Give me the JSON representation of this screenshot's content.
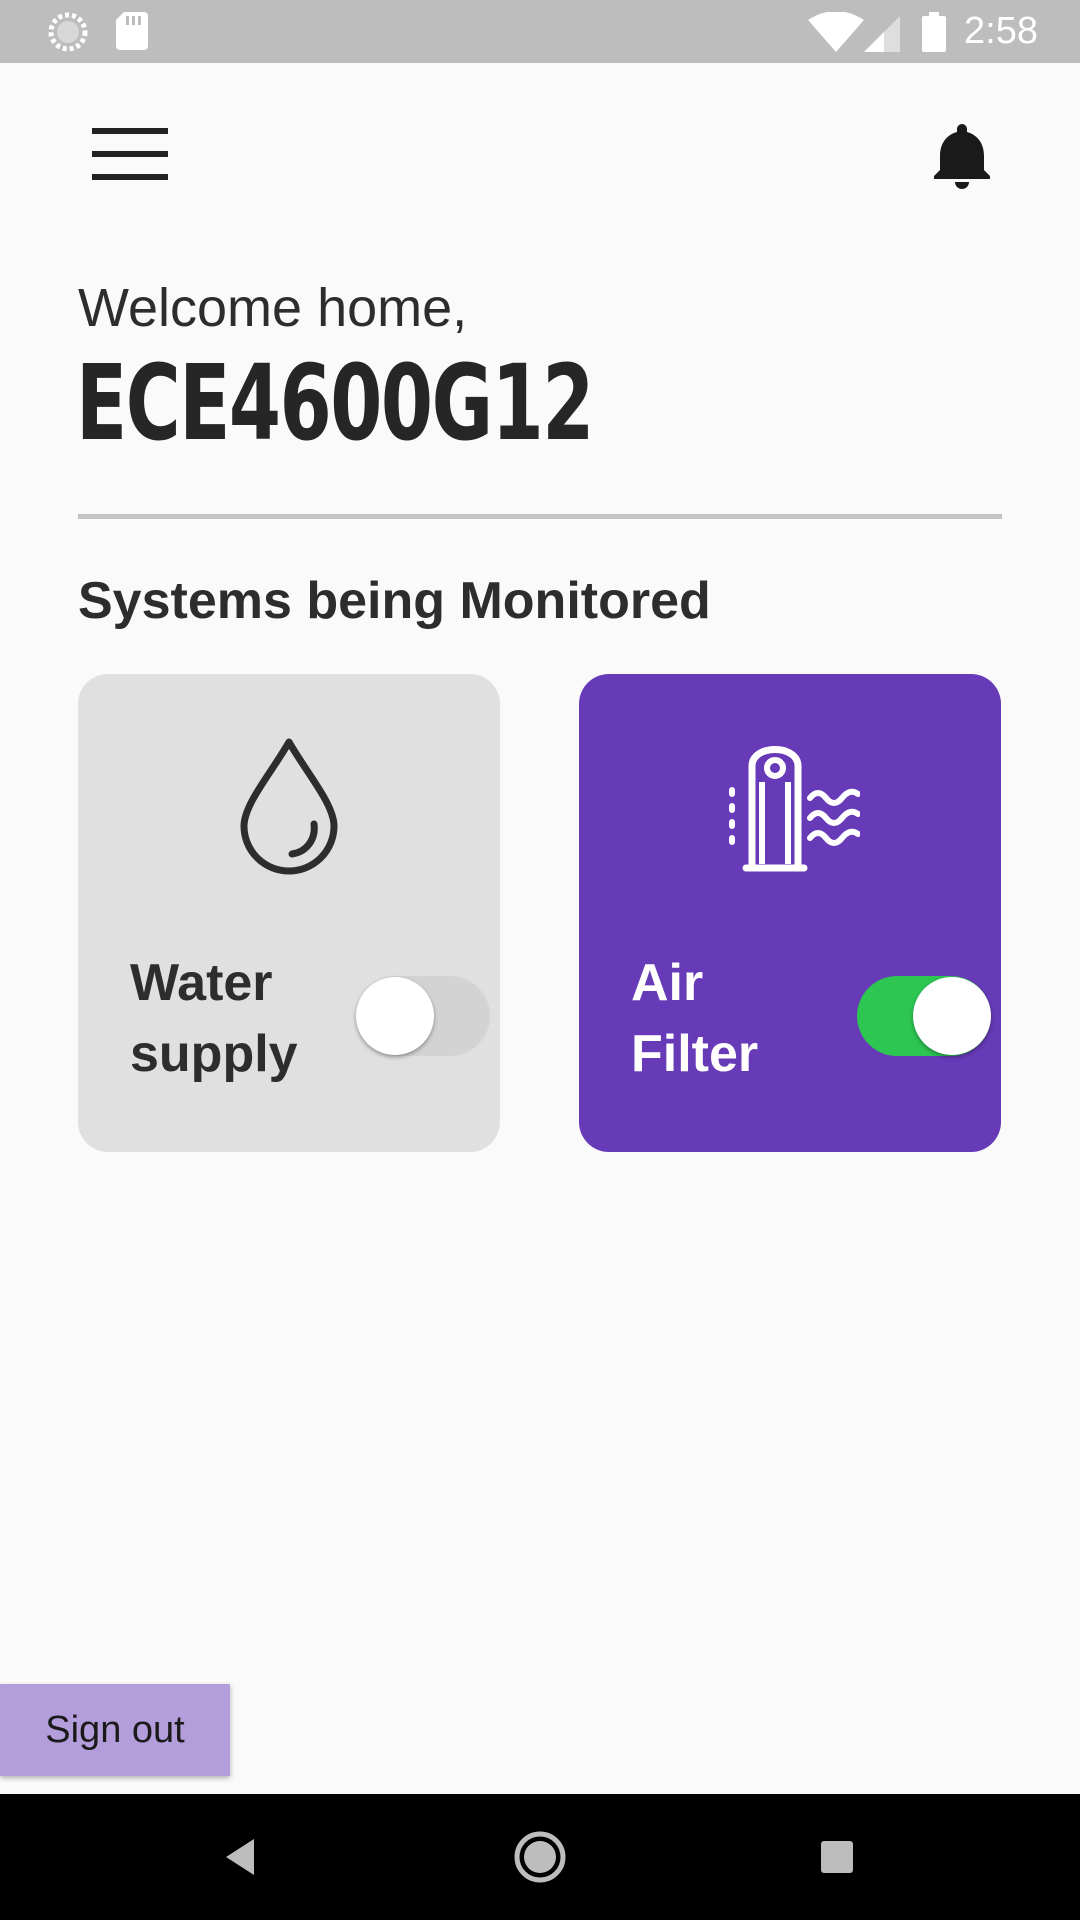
{
  "status_bar": {
    "time": "2:58",
    "left_icons": [
      "sync-icon",
      "sd-card-icon"
    ],
    "right_icons": [
      "wifi-icon",
      "cellular-signal-icon",
      "battery-icon"
    ]
  },
  "header": {
    "menu_icon": "hamburger-menu-icon",
    "notification_icon": "bell-icon"
  },
  "welcome": {
    "greeting": "Welcome home,",
    "username": "ECE4600G12"
  },
  "systems": {
    "title": "Systems being Monitored",
    "cards": [
      {
        "label": "Water\nsupply",
        "icon": "water-drop-icon",
        "enabled": false,
        "background": "#e0e0e0"
      },
      {
        "label": "Air\nFilter",
        "icon": "air-purifier-icon",
        "enabled": true,
        "background": "#673ab7"
      }
    ]
  },
  "footer": {
    "sign_out_label": "Sign out"
  },
  "nav_bar": {
    "buttons": [
      "back-icon",
      "home-icon",
      "recents-icon"
    ]
  },
  "colors": {
    "accent_purple": "#673ab7",
    "signout_purple": "#b39ddb",
    "toggle_on": "#2dc653",
    "toggle_off": "#d3d3d3",
    "status_bar": "#bdbdbd"
  }
}
